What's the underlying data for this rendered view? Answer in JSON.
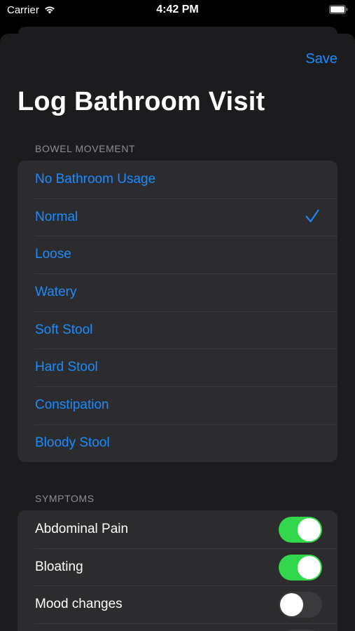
{
  "status_bar": {
    "carrier": "Carrier",
    "time": "4:42 PM"
  },
  "header": {
    "save_label": "Save",
    "title": "Log Bathroom Visit"
  },
  "bowel_movement": {
    "header": "BOWEL MOVEMENT",
    "selected": "Normal",
    "options": [
      "No Bathroom Usage",
      "Normal",
      "Loose",
      "Watery",
      "Soft Stool",
      "Hard Stool",
      "Constipation",
      "Bloody Stool"
    ]
  },
  "symptoms": {
    "header": "SYMPTOMS",
    "items": [
      {
        "label": "Abdominal Pain",
        "on": true
      },
      {
        "label": "Bloating",
        "on": true
      },
      {
        "label": "Mood changes",
        "on": false
      },
      {
        "label": "",
        "on": false
      }
    ]
  },
  "colors": {
    "accent": "#1a8cff",
    "toggle_on": "#32d74b",
    "toggle_off": "#3a3a3c",
    "background": "#1c1c1e",
    "cell": "#2c2c2e"
  }
}
